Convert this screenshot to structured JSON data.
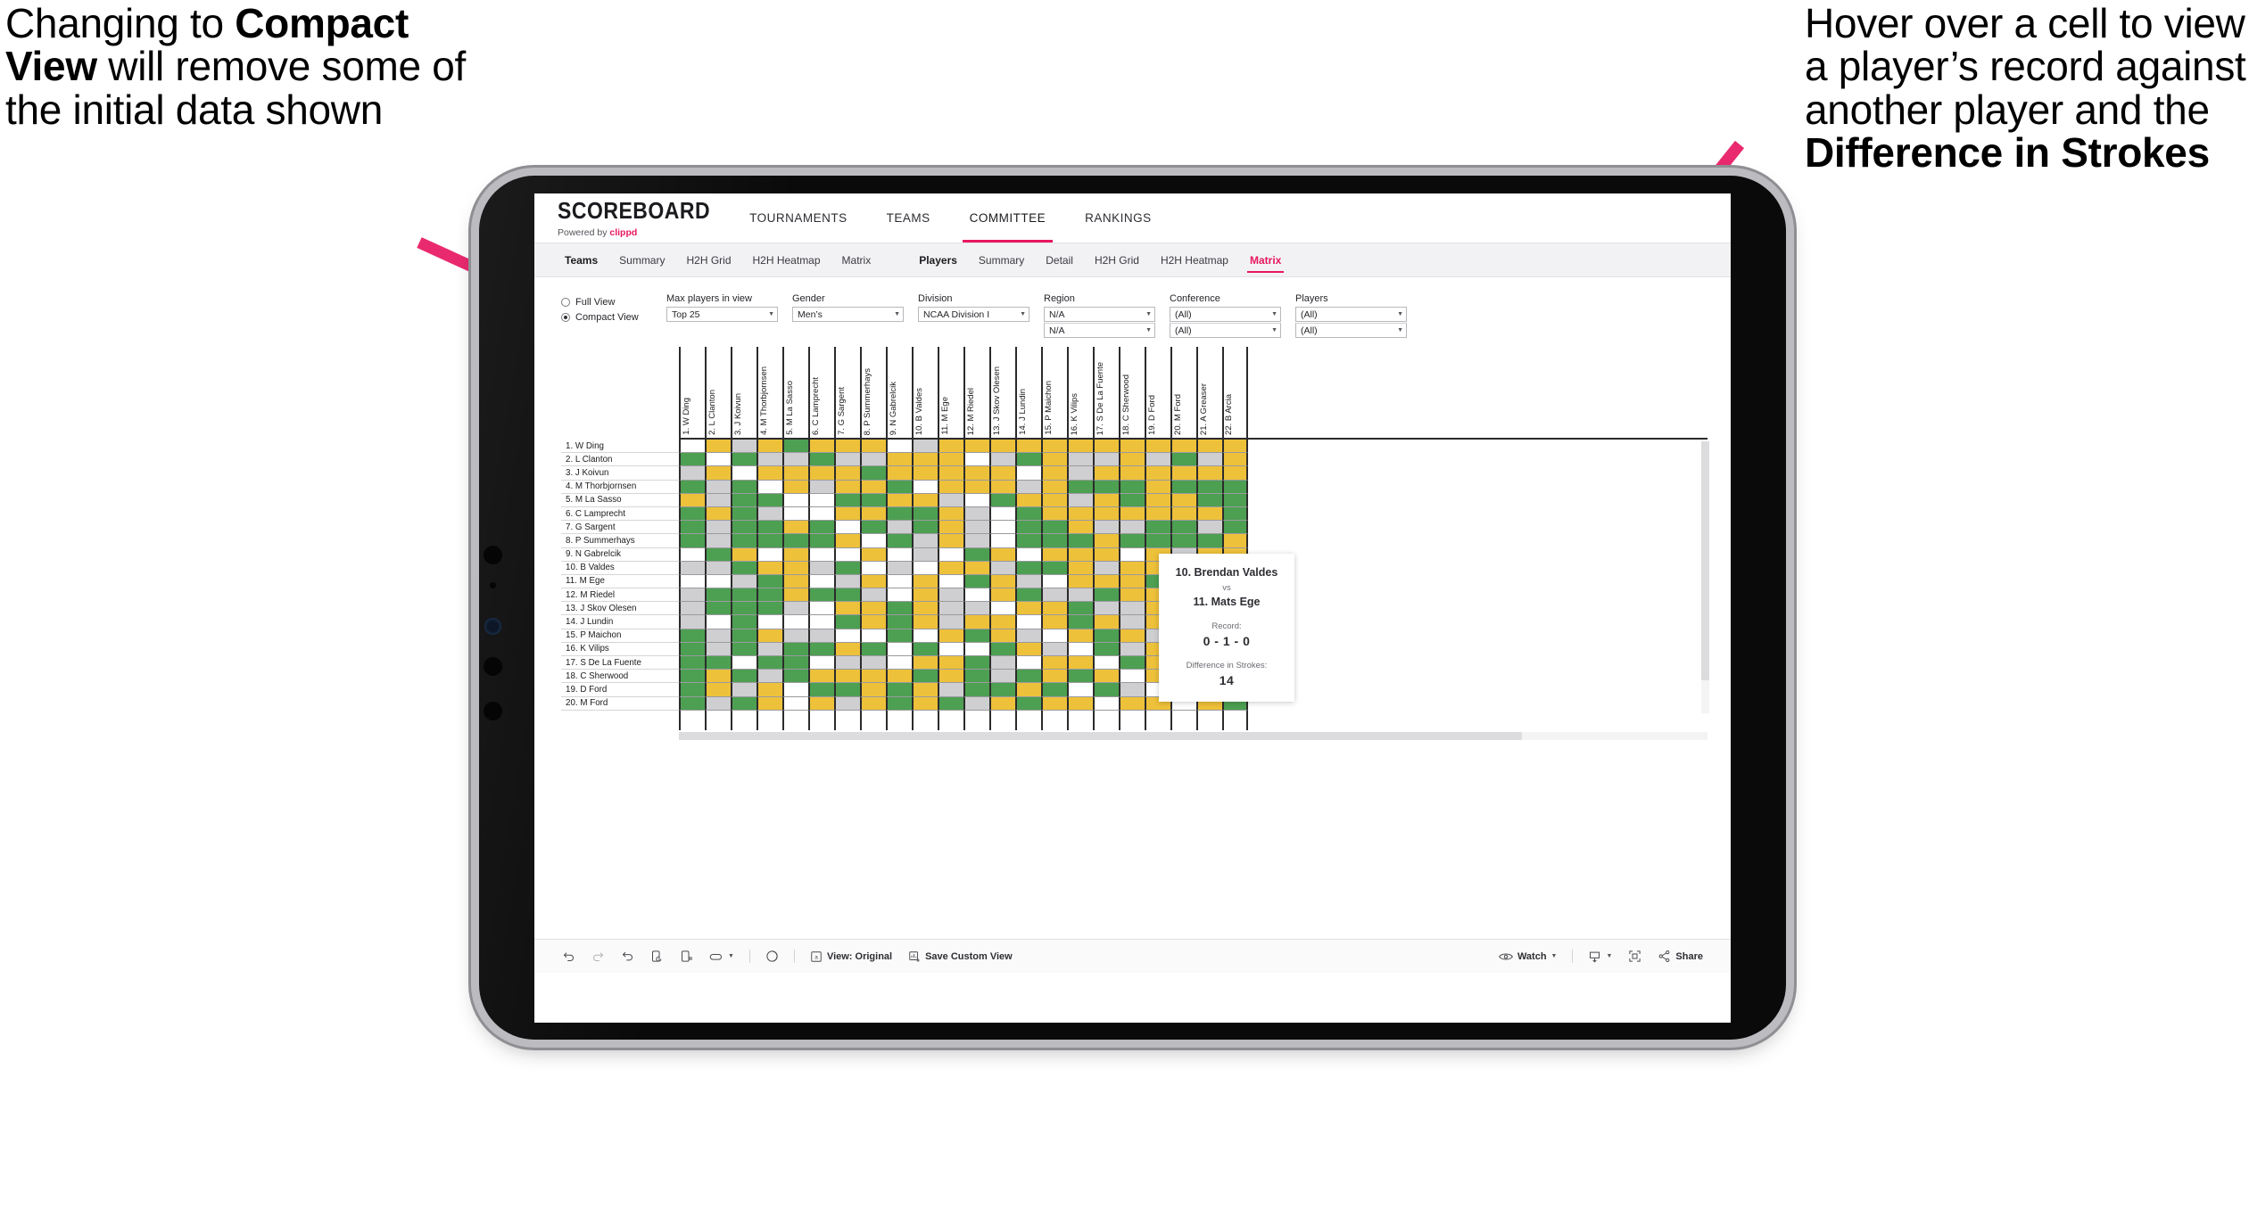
{
  "annotations": {
    "left": {
      "line1": "Changing to ",
      "bold1": "Compact View",
      "line2": " will remove some of the initial data shown"
    },
    "right": {
      "line1": "Hover over a cell to view a player’s record against another player and the ",
      "bold1": "Difference in Strokes"
    }
  },
  "app": {
    "brand": {
      "title": "SCOREBOARD",
      "powered_prefix": "Powered by ",
      "powered_brand": "clippd"
    },
    "nav": [
      {
        "label": "TOURNAMENTS",
        "active": false
      },
      {
        "label": "TEAMS",
        "active": false
      },
      {
        "label": "COMMITTEE",
        "active": true
      },
      {
        "label": "RANKINGS",
        "active": false
      }
    ],
    "subtabs_teams": [
      {
        "label": "Teams",
        "head": true,
        "active": false
      },
      {
        "label": "Summary",
        "head": false,
        "active": false
      },
      {
        "label": "H2H Grid",
        "head": false,
        "active": false
      },
      {
        "label": "H2H Heatmap",
        "head": false,
        "active": false
      },
      {
        "label": "Matrix",
        "head": false,
        "active": false
      }
    ],
    "subtabs_players": [
      {
        "label": "Players",
        "head": true,
        "active": false
      },
      {
        "label": "Summary",
        "head": false,
        "active": false
      },
      {
        "label": "Detail",
        "head": false,
        "active": false
      },
      {
        "label": "H2H Grid",
        "head": false,
        "active": false
      },
      {
        "label": "H2H Heatmap",
        "head": false,
        "active": false
      },
      {
        "label": "Matrix",
        "head": false,
        "active": true
      }
    ]
  },
  "filters": {
    "view_mode": {
      "full_label": "Full View",
      "compact_label": "Compact View",
      "selected": "compact"
    },
    "groups": [
      {
        "label": "Max players in view",
        "values": [
          "Top 25"
        ]
      },
      {
        "label": "Gender",
        "values": [
          "Men’s"
        ]
      },
      {
        "label": "Division",
        "values": [
          "NCAA Division I"
        ]
      },
      {
        "label": "Region",
        "values": [
          "N/A",
          "N/A"
        ]
      },
      {
        "label": "Conference",
        "values": [
          "(All)",
          "(All)"
        ]
      },
      {
        "label": "Players",
        "values": [
          "(All)",
          "(All)"
        ]
      }
    ]
  },
  "matrix": {
    "row_labels": [
      "1. W Ding",
      "2. L Clanton",
      "3. J Koivun",
      "4. M Thorbjornsen",
      "5. M La Sasso",
      "6. C Lamprecht",
      "7. G Sargent",
      "8. P Summerhays",
      "9. N Gabrelcik",
      "10. B Valdes",
      "11. M Ege",
      "12. M Riedel",
      "13. J Skov Olesen",
      "14. J Lundin",
      "15. P Maichon",
      "16. K Vilips",
      "17. S De La Fuente",
      "18. C Sherwood",
      "19. D Ford",
      "20. M Ford"
    ],
    "col_labels": [
      "1. W Ding",
      "2. L Clanton",
      "3. J Koivun",
      "4. M Thorbjornsen",
      "5. M La Sasso",
      "6. C Lamprecht",
      "7. G Sargent",
      "8. P Summerhays",
      "9. N Gabrelcik",
      "10. B Valdes",
      "11. M Ege",
      "12. M Riedel",
      "13. J Skov Olesen",
      "14. J Lundin",
      "15. P Maichon",
      "16. K Vilips",
      "17. S De La Fuente",
      "18. C Sherwood",
      "19. D Ford",
      "20. M Ford",
      "21. A Greaser",
      "22. B Arcia"
    ],
    "legend_colors": {
      "win": "#4da051",
      "tie": "#eec13a",
      "loss": "#cfcfd2",
      "none": "#ffffff"
    },
    "cells": [
      [
        "w",
        "y",
        "a",
        "y",
        "g",
        "y",
        "y",
        "y",
        "w",
        "a",
        "y",
        "y",
        "y",
        "y",
        "y",
        "y",
        "y",
        "y",
        "y",
        "y",
        "y",
        "y"
      ],
      [
        "g",
        "w",
        "g",
        "a",
        "a",
        "g",
        "a",
        "a",
        "y",
        "y",
        "y",
        "w",
        "a",
        "g",
        "y",
        "a",
        "a",
        "y",
        "a",
        "g",
        "a",
        "y"
      ],
      [
        "a",
        "y",
        "w",
        "y",
        "y",
        "y",
        "y",
        "g",
        "y",
        "y",
        "y",
        "y",
        "y",
        "w",
        "y",
        "a",
        "y",
        "y",
        "y",
        "y",
        "y",
        "y"
      ],
      [
        "g",
        "a",
        "g",
        "w",
        "y",
        "a",
        "y",
        "y",
        "g",
        "w",
        "y",
        "y",
        "y",
        "a",
        "y",
        "g",
        "g",
        "g",
        "y",
        "g",
        "g",
        "g"
      ],
      [
        "y",
        "a",
        "g",
        "g",
        "w",
        "w",
        "g",
        "g",
        "y",
        "y",
        "a",
        "w",
        "g",
        "y",
        "y",
        "a",
        "y",
        "g",
        "y",
        "y",
        "g",
        "g"
      ],
      [
        "g",
        "y",
        "g",
        "a",
        "w",
        "w",
        "y",
        "y",
        "g",
        "g",
        "y",
        "a",
        "w",
        "g",
        "y",
        "y",
        "y",
        "y",
        "y",
        "y",
        "y",
        "g"
      ],
      [
        "g",
        "a",
        "g",
        "g",
        "y",
        "g",
        "w",
        "g",
        "a",
        "g",
        "y",
        "a",
        "w",
        "g",
        "g",
        "y",
        "a",
        "a",
        "g",
        "g",
        "a",
        "g"
      ],
      [
        "g",
        "a",
        "g",
        "g",
        "g",
        "g",
        "y",
        "w",
        "g",
        "a",
        "y",
        "a",
        "w",
        "g",
        "g",
        "g",
        "y",
        "g",
        "g",
        "g",
        "g",
        "y"
      ],
      [
        "w",
        "g",
        "y",
        "w",
        "y",
        "w",
        "w",
        "y",
        "w",
        "a",
        "w",
        "g",
        "y",
        "w",
        "y",
        "y",
        "y",
        "w",
        "y",
        "a",
        "y",
        "y"
      ],
      [
        "a",
        "a",
        "g",
        "y",
        "y",
        "a",
        "g",
        "w",
        "a",
        "w",
        "y",
        "y",
        "a",
        "g",
        "g",
        "y",
        "a",
        "y",
        "y",
        "y",
        "g",
        "g"
      ],
      [
        "w",
        "w",
        "a",
        "g",
        "y",
        "w",
        "a",
        "y",
        "w",
        "y",
        "w",
        "g",
        "y",
        "a",
        "w",
        "y",
        "y",
        "y",
        "g",
        "y",
        "y",
        "w"
      ],
      [
        "a",
        "g",
        "g",
        "g",
        "y",
        "g",
        "g",
        "a",
        "w",
        "y",
        "a",
        "w",
        "y",
        "g",
        "a",
        "a",
        "g",
        "y",
        "y",
        "g",
        "y",
        "y"
      ],
      [
        "a",
        "g",
        "g",
        "g",
        "a",
        "w",
        "y",
        "y",
        "g",
        "y",
        "a",
        "a",
        "w",
        "y",
        "y",
        "g",
        "a",
        "a",
        "y",
        "g",
        "g",
        "y"
      ],
      [
        "a",
        "w",
        "g",
        "w",
        "w",
        "w",
        "g",
        "y",
        "g",
        "y",
        "a",
        "y",
        "y",
        "w",
        "y",
        "g",
        "y",
        "a",
        "y",
        "g",
        "y",
        "g"
      ],
      [
        "g",
        "a",
        "g",
        "y",
        "a",
        "a",
        "w",
        "w",
        "g",
        "w",
        "y",
        "g",
        "y",
        "a",
        "w",
        "y",
        "g",
        "y",
        "a",
        "g",
        "y",
        "g"
      ],
      [
        "g",
        "a",
        "g",
        "a",
        "g",
        "g",
        "y",
        "g",
        "w",
        "g",
        "w",
        "w",
        "g",
        "y",
        "a",
        "w",
        "g",
        "a",
        "y",
        "a",
        "g",
        "g"
      ],
      [
        "g",
        "g",
        "w",
        "g",
        "g",
        "w",
        "a",
        "a",
        "w",
        "y",
        "y",
        "g",
        "a",
        "w",
        "y",
        "y",
        "w",
        "g",
        "y",
        "g",
        "y",
        "g"
      ],
      [
        "g",
        "y",
        "g",
        "a",
        "g",
        "y",
        "y",
        "y",
        "y",
        "g",
        "y",
        "g",
        "a",
        "g",
        "y",
        "g",
        "y",
        "w",
        "y",
        "y",
        "y",
        "g"
      ],
      [
        "g",
        "y",
        "a",
        "y",
        "w",
        "g",
        "g",
        "y",
        "g",
        "y",
        "a",
        "g",
        "g",
        "y",
        "g",
        "w",
        "g",
        "a",
        "w",
        "y",
        "g",
        "g"
      ],
      [
        "g",
        "a",
        "g",
        "y",
        "w",
        "y",
        "a",
        "y",
        "g",
        "y",
        "g",
        "a",
        "y",
        "g",
        "y",
        "y",
        "w",
        "y",
        "y",
        "w",
        "y",
        "g"
      ]
    ]
  },
  "tooltip": {
    "player_a": "10. Brendan Valdes",
    "vs": "vs",
    "player_b": "11. Mats Ege",
    "record_label": "Record:",
    "record_value": "0 - 1 - 0",
    "diff_label": "Difference in Strokes:",
    "diff_value": "14"
  },
  "toolbar": {
    "view_label": "View: Original",
    "save_label": "Save Custom View",
    "watch_label": "Watch",
    "share_label": "Share"
  }
}
